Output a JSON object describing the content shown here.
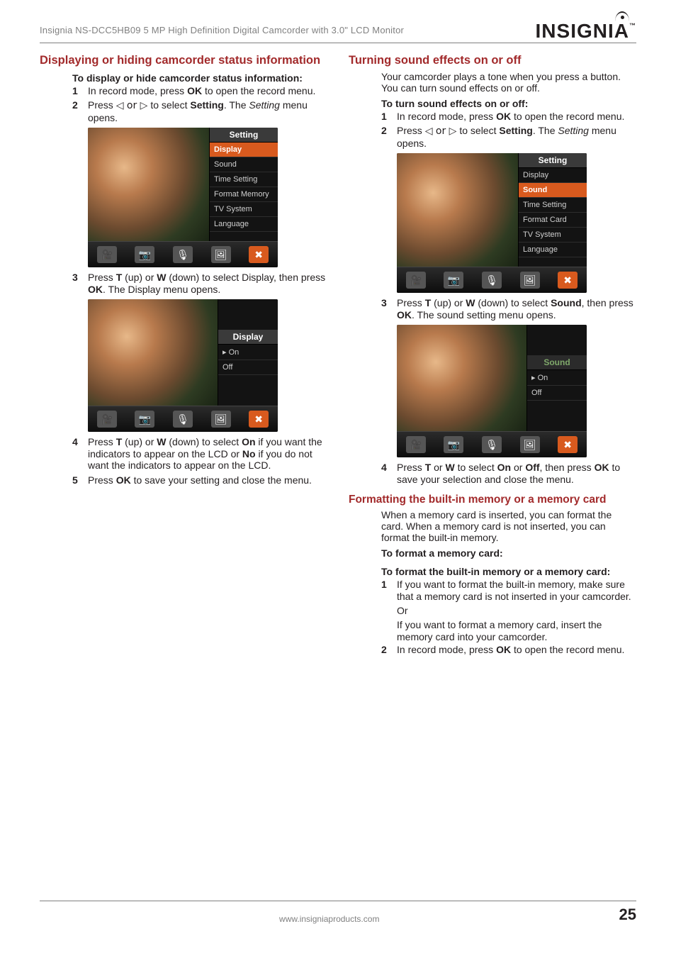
{
  "header": {
    "product": "Insignia NS-DCC5HB09 5 MP High Definition Digital Camcorder with 3.0\" LCD Monitor",
    "brand": "INSIGNIA",
    "tm": "™"
  },
  "left": {
    "heading": "Displaying or hiding camcorder status information",
    "subheading": "To display or hide camcorder status information:",
    "steps": {
      "s1": {
        "num": "1",
        "pre": "In record mode, press ",
        "bold1": "OK",
        "post": " to open the record menu."
      },
      "s2": {
        "num": "2",
        "a": "Press ",
        "arrows": "◁ or ▷",
        "b": " to select ",
        "bold1": "Setting",
        "c": ". The ",
        "italic1": "Setting",
        "d": " menu opens."
      },
      "s3": {
        "num": "3",
        "a": "Press ",
        "bold1": "T",
        "b": " (up) or ",
        "bold2": "W",
        "c": " (down) to select Display, then press ",
        "bold3": "OK",
        "d": ". The Display menu opens."
      },
      "s4": {
        "num": "4",
        "a": "Press ",
        "bold1": "T",
        "b": " (up) or ",
        "bold2": "W",
        "c": " (down) to select ",
        "bold3": "On",
        "d": " if you want the indicators to appear on the LCD or ",
        "bold4": "No",
        "e": " if you do not want the indicators to appear on the LCD."
      },
      "s5": {
        "num": "5",
        "a": "Press ",
        "bold1": "OK",
        "b": " to save your setting and close the menu."
      }
    },
    "shot1": {
      "title": "Setting",
      "items": [
        "Display",
        "Sound",
        "Time Setting",
        "Format Memory",
        "TV System",
        "Language"
      ],
      "selected": 0
    },
    "shot2": {
      "title": "Display",
      "items": [
        "▸ On",
        "Off"
      ],
      "selected": 0
    }
  },
  "right": {
    "heading1": "Turning sound effects on or off",
    "intro1": "Your camcorder plays a tone when you press a button. You can turn sound effects on or off.",
    "sub1": "To turn sound effects on or off:",
    "steps1": {
      "s1": {
        "num": "1",
        "pre": "In record mode, press ",
        "bold1": "OK",
        "post": " to open the record menu."
      },
      "s2": {
        "num": "2",
        "a": "Press ",
        "arrows": "◁ or ▷",
        "b": " to select ",
        "bold1": "Setting",
        "c": ". The ",
        "italic1": "Setting",
        "d": " menu opens."
      },
      "s3": {
        "num": "3",
        "a": "Press ",
        "bold1": "T",
        "b": " (up) or ",
        "bold2": "W",
        "c": " (down) to select ",
        "bold3": "Sound",
        "d": ", then press ",
        "bold4": "OK",
        "e": ". The sound setting menu opens."
      },
      "s4": {
        "num": "4",
        "a": "Press ",
        "bold1": "T",
        "b": " or ",
        "bold2": "W",
        "c": " to select ",
        "bold3": "On",
        "d": " or ",
        "bold4": "Off",
        "e": ", then press ",
        "bold5": "OK",
        "f": " to save your selection and close the menu."
      }
    },
    "shot1": {
      "title": "Setting",
      "items": [
        "Display",
        "Sound",
        "Time Setting",
        "Format Card",
        "TV System",
        "Language"
      ],
      "selected": 1
    },
    "shot2": {
      "title": "Sound",
      "items": [
        "▸ On",
        "Off"
      ],
      "selected": 0
    },
    "heading2": "Formatting the built-in memory or a memory card",
    "intro2": "When a memory card is inserted, you can format the card. When a memory card is not inserted, you can format the built-in memory.",
    "sub2": "To format a memory card:",
    "sub3": "To format the built-in memory or a memory card:",
    "steps2": {
      "s1": {
        "num": "1",
        "text": "If you want to format the built-in memory, make sure that a memory card is not inserted in your camcorder."
      },
      "or": "Or",
      "s1b": "If you want to format a memory card, insert the memory card into your camcorder.",
      "s2": {
        "num": "2",
        "a": "In record mode, press ",
        "bold1": "OK",
        "b": " to open the record menu."
      }
    }
  },
  "footer": {
    "url": "www.insigniaproducts.com",
    "page": "25"
  },
  "icons": [
    "🎥",
    "📷",
    "🎙",
    "🖼",
    "✖"
  ]
}
